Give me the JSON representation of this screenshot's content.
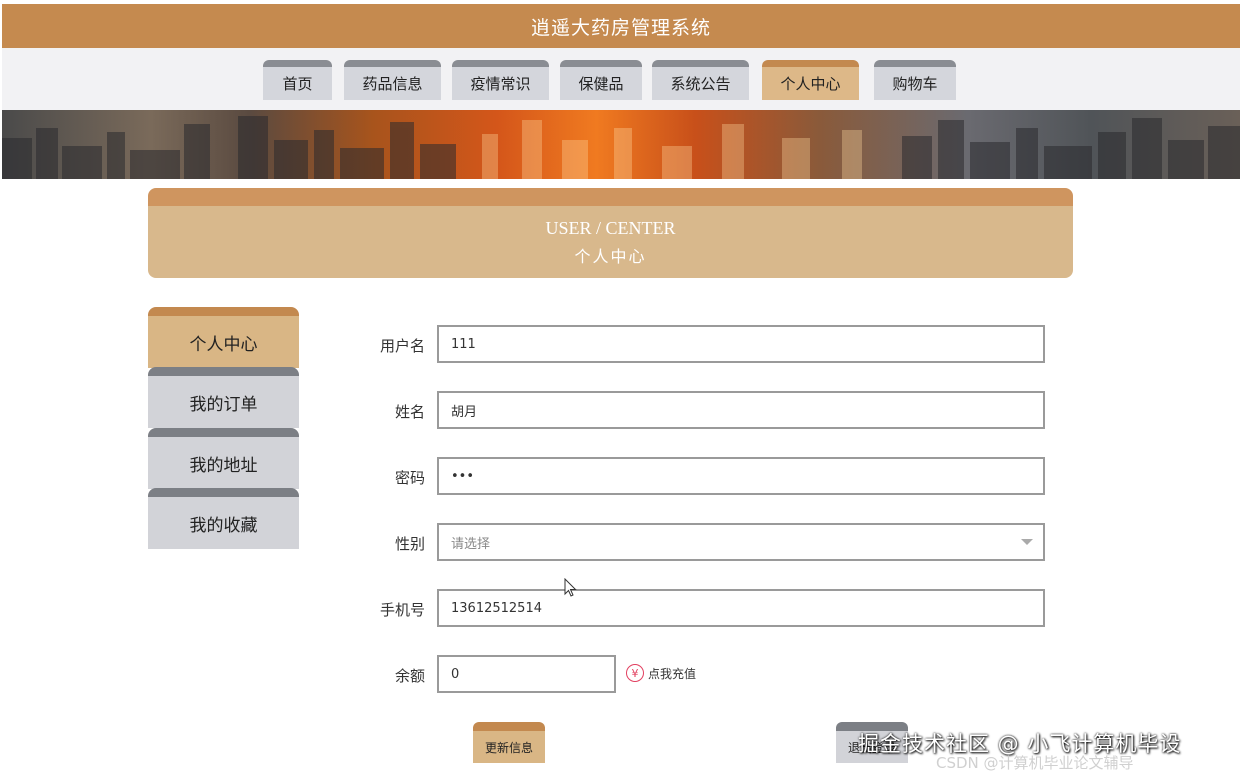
{
  "app": {
    "title": "逍遥大药房管理系统"
  },
  "nav": {
    "tabs": [
      {
        "label": "首页"
      },
      {
        "label": "药品信息"
      },
      {
        "label": "疫情常识"
      },
      {
        "label": "保健品"
      },
      {
        "label": "系统公告"
      },
      {
        "label": "个人中心",
        "active": true
      },
      {
        "label": "购物车"
      }
    ]
  },
  "center": {
    "title_en": "USER / CENTER",
    "title_zh": "个人中心"
  },
  "sidebar": {
    "items": [
      {
        "label": "个人中心",
        "active": true
      },
      {
        "label": "我的订单"
      },
      {
        "label": "我的地址"
      },
      {
        "label": "我的收藏"
      }
    ]
  },
  "form": {
    "username": {
      "label": "用户名",
      "value": "111"
    },
    "name": {
      "label": "姓名",
      "value": "胡月"
    },
    "password": {
      "label": "密码",
      "value": "•••"
    },
    "gender": {
      "label": "性别",
      "placeholder": "请选择"
    },
    "phone": {
      "label": "手机号",
      "value": "13612512514"
    },
    "balance": {
      "label": "余额",
      "value": "0"
    },
    "recharge": {
      "icon": "yen-icon",
      "label": "点我充值"
    }
  },
  "buttons": {
    "update": "更新信息",
    "logout": "退出登录"
  },
  "watermark": {
    "main": "掘金技术社区 @ 小飞计算机毕设",
    "sub": "CSDN @计算机毕业论文辅导"
  },
  "colors": {
    "header": "#c58a4f",
    "accent": "#d9b685",
    "inactive_tab": "#d2d3d8"
  }
}
